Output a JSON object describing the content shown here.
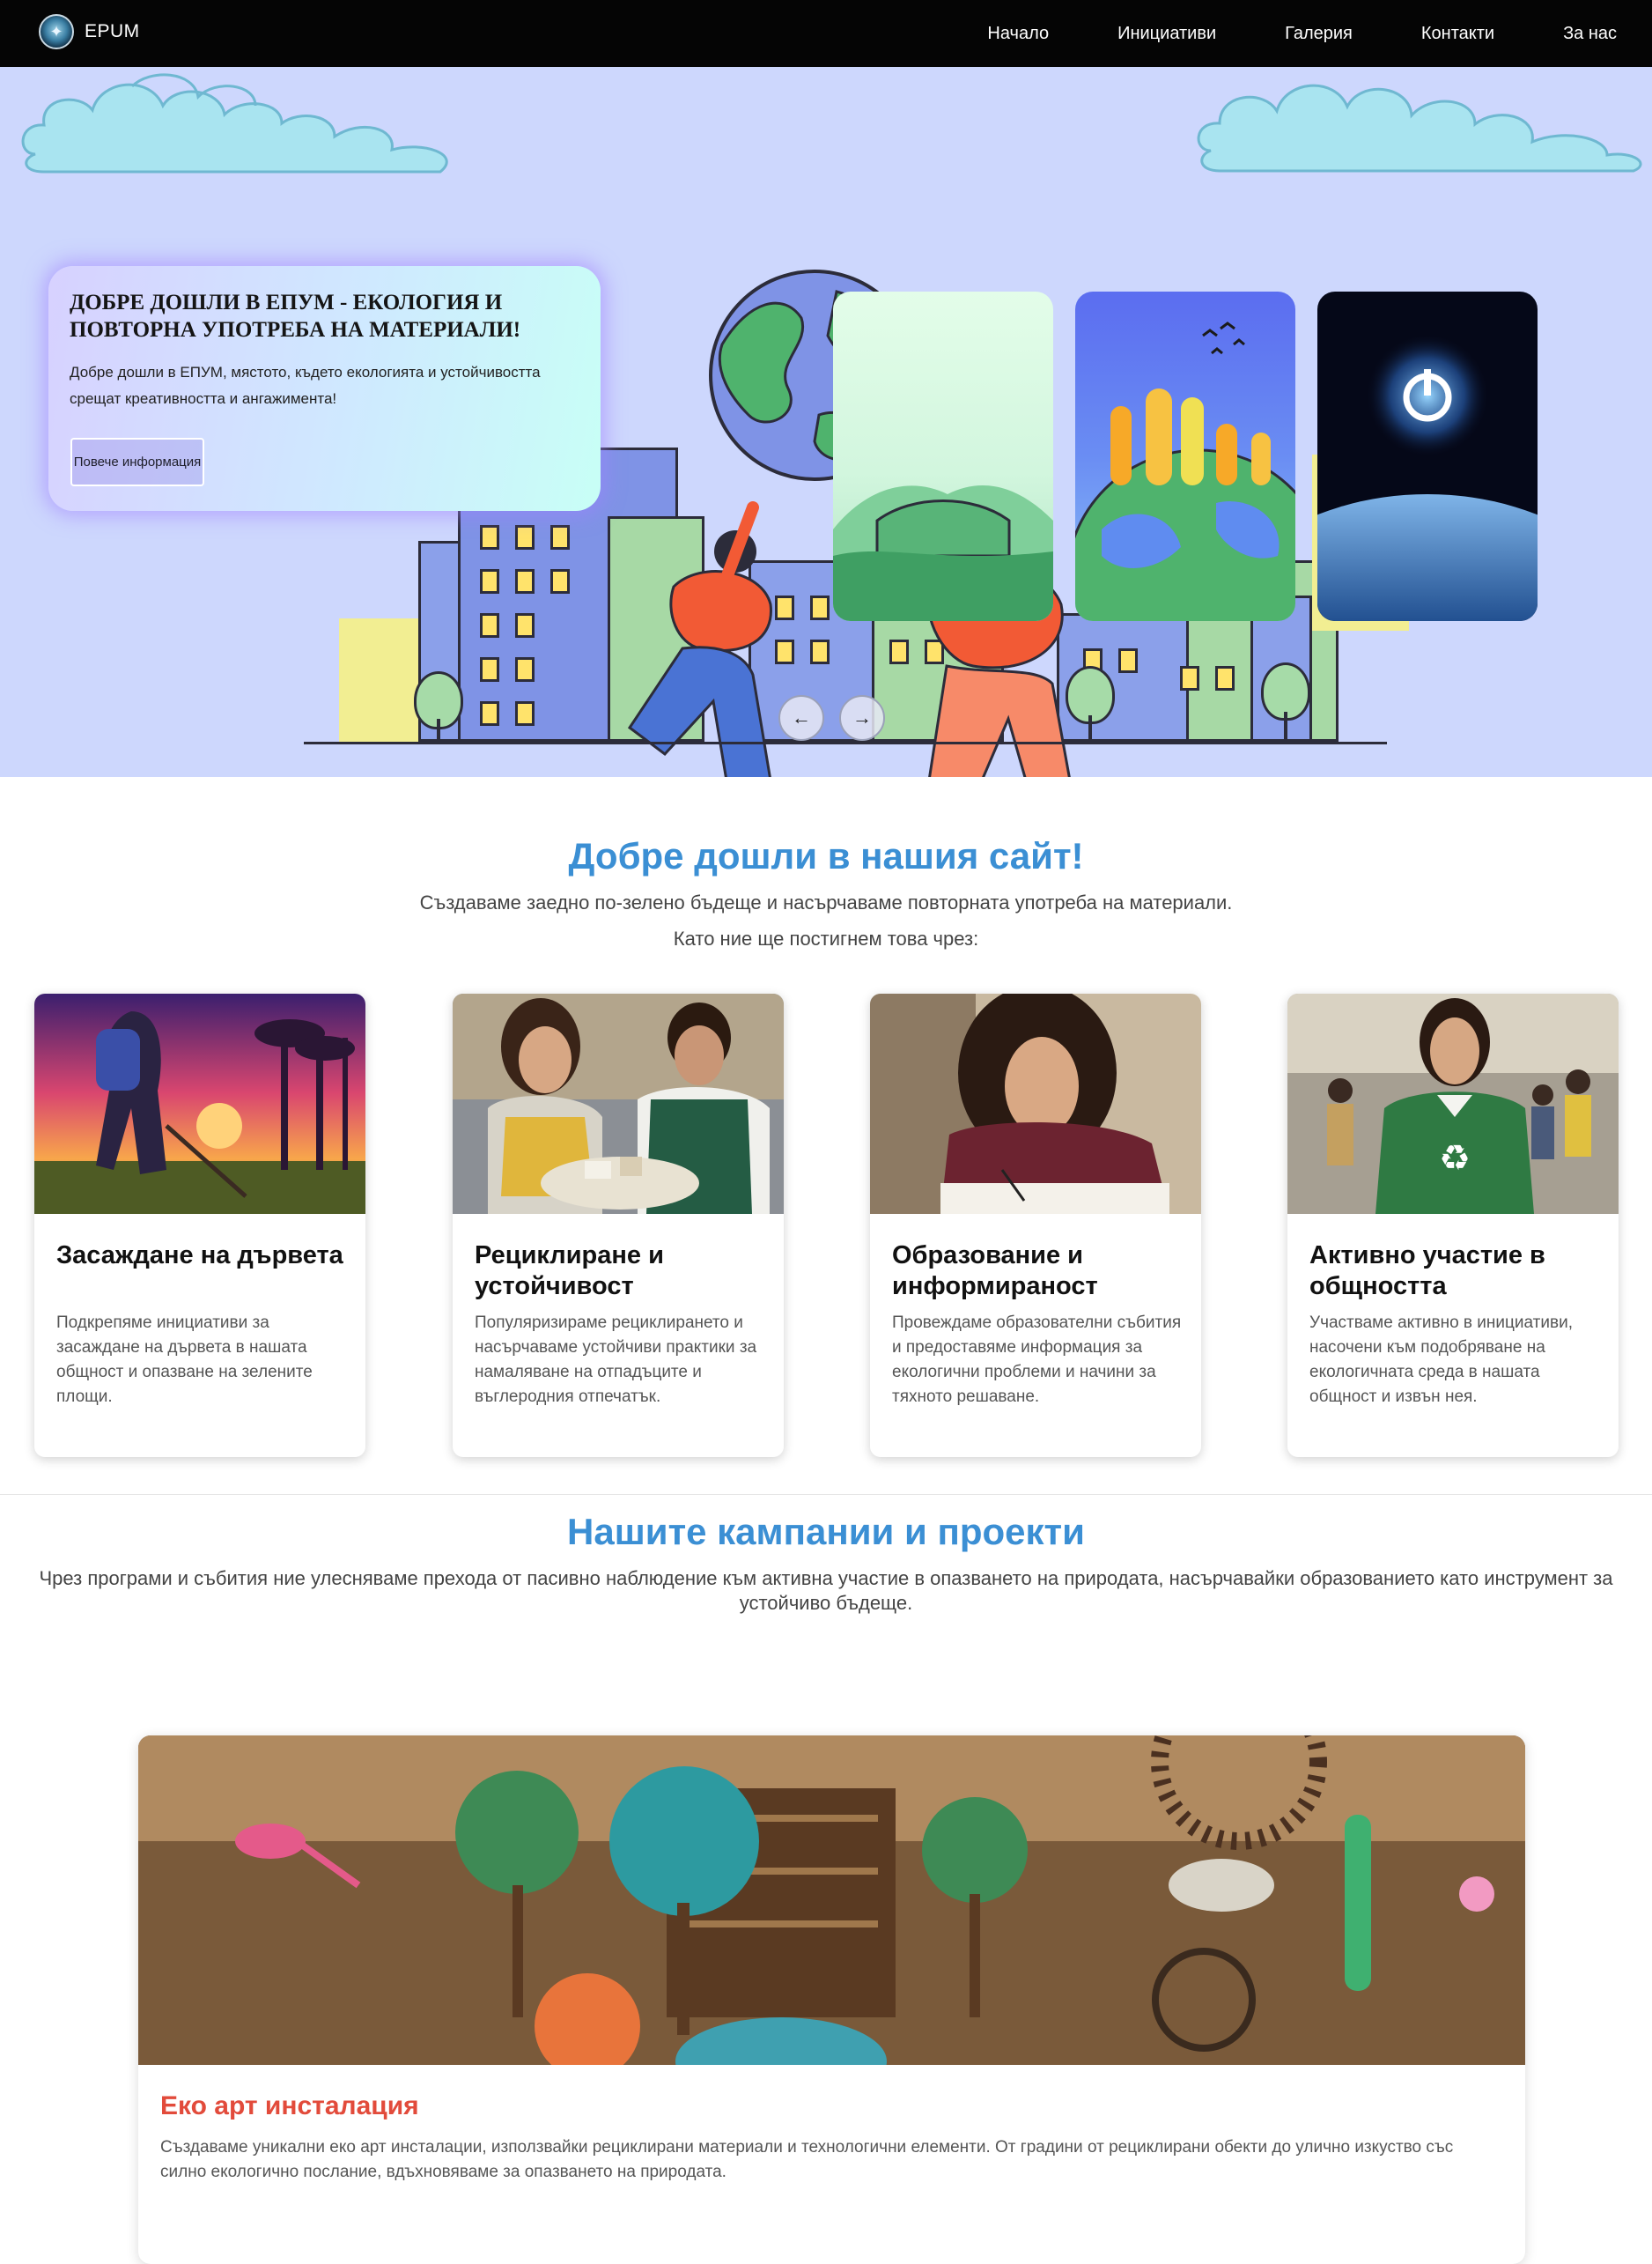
{
  "nav": {
    "brand": "EPUM",
    "links": [
      "Начало",
      "Инициативи",
      "Галерия",
      "Контакти",
      "За нас"
    ]
  },
  "hero": {
    "title": "ДОБРЕ ДОШЛИ В ЕПУМ - ЕКОЛОГИЯ И ПОВТОРНА УПОТРЕБА НА МАТЕРИАЛИ!",
    "text": "Добре дошли в ЕПУМ, мястото, където екологията и устойчивостта срещат креативността и ангажимента!",
    "button": "Повече информация",
    "prev_icon": "arrow-left-icon",
    "next_icon": "arrow-right-icon"
  },
  "welcome": {
    "title": "Добре дошли в нашия сайт!",
    "subtitle": "Създаваме заедно по-зелено бъдеще и насърчаваме повторната употреба на материали.",
    "lead": "Като ние ще постигнем това чрез:"
  },
  "cards": [
    {
      "title": "Засаждане на дървета",
      "text": "Подкрепяме инициативи за засаждане на дървета в нашата общност и опазване на зелените площи."
    },
    {
      "title": "Рециклиране и устойчивост",
      "text": "Популяризираме рециклирането и насърчаваме устойчиви практики за намаляване на отпадъците и въглеродния отпечатък."
    },
    {
      "title": "Образование и информираност",
      "text": "Провеждаме образователни събития и предоставяме информация за екологични проблеми и начини за тяхното решаване."
    },
    {
      "title": "Активно участие в общността",
      "text": "Участваме активно в инициативи, насочени към подобряване на екологичната среда в нашата общност и извън нея."
    }
  ],
  "campaigns": {
    "title": "Нашите кампании и проекти",
    "text": "Чрез програми и събития ние улесняваме прехода от пасивно наблюдение към активна участие в опазването на природата, насърчавайки образованието като инструмент за устойчиво бъдеще."
  },
  "project": {
    "title": "Еко арт инсталация",
    "text": "Създаваме уникални еко арт инсталации, използвайки рециклирани материали и технологични елементи. От градини от рециклирани обекти до улично изкуство със силно екологично послание, вдъхновяваме за опазването на природата."
  },
  "colors": {
    "accent_blue": "#3b8fd4",
    "accent_red": "#e24b3b",
    "hero_bg": "#cdd7fd",
    "nav_bg": "#050505"
  }
}
